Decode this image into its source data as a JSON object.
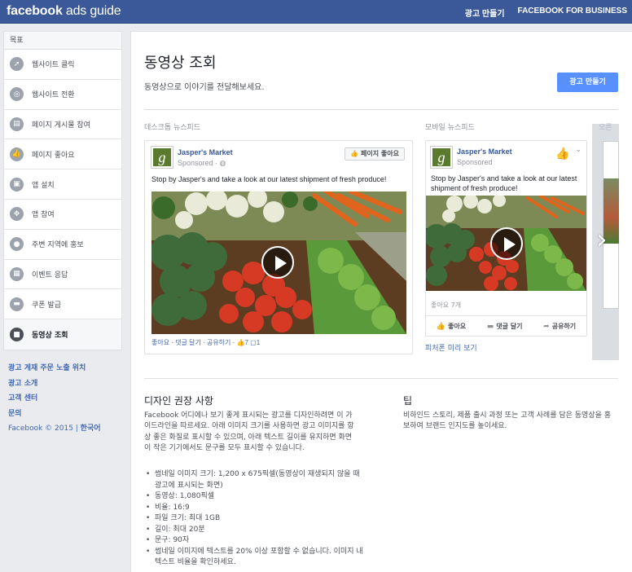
{
  "header": {
    "logo_bold": "facebook",
    "logo_thin": " ads guide",
    "nav": [
      "광고 만들기",
      "FACEBOOK FOR BUSINESS"
    ]
  },
  "sidebar": {
    "heading": "목표",
    "items": [
      {
        "label": "웹사이트 클릭",
        "icon": "cursor-icon"
      },
      {
        "label": "웹사이트 전환",
        "icon": "target-icon"
      },
      {
        "label": "페이지 게시물 참여",
        "icon": "post-icon"
      },
      {
        "label": "페이지 좋아요",
        "icon": "thumbs-up-icon"
      },
      {
        "label": "앱 설치",
        "icon": "box-icon"
      },
      {
        "label": "앱 참여",
        "icon": "controller-icon"
      },
      {
        "label": "주변 지역에 홍보",
        "icon": "location-pin-icon"
      },
      {
        "label": "이벤트 응답",
        "icon": "calendar-icon"
      },
      {
        "label": "쿠폰 발급",
        "icon": "coupon-icon"
      },
      {
        "label": "동영상 조회",
        "icon": "video-camera-icon"
      }
    ],
    "active_index": 9,
    "links": [
      "광고 게재 주문 노출 위치",
      "광고 소개",
      "고객 센터",
      "문의"
    ],
    "copyright": "Facebook © 2015 | ",
    "language": "한국어"
  },
  "main": {
    "title": "동영상 조회",
    "subtitle": "동영상으로 이야기를 전달해보세요.",
    "create_button": "광고 만들기",
    "desktop_label": "데스크톱 뉴스피드",
    "mobile_label": "모바일 뉴스피드",
    "right_label": "오른",
    "mobile_preview_link": "피처폰 미리 보기"
  },
  "ad": {
    "brand": "Jasper's Market",
    "logo_letter": "g",
    "sponsored": "Sponsored",
    "text": "Stop by Jasper's and take a look at our latest shipment of fresh produce!",
    "like_page_button": "👍 페이지 좋아요",
    "desktop_actions": "좋아요 · 댓글 달기 · 공유하기 · ",
    "like_count": "7",
    "comment_count": "1",
    "mobile_likes": "좋아요 7개",
    "mobile_like": "좋아요",
    "mobile_comment": "댓글 달기",
    "mobile_share": "공유하기"
  },
  "design": {
    "title": "디자인 권장 사항",
    "body": "Facebook 어디에나 보기 좋게 표시되는 광고를 디자인하려면 이 가이드라인을 따르세요. 아래 이미지 크기를 사용하면 광고 이미지를 항상 좋은 화질로 표시할 수 있으며, 아래 텍스트 길이를 유지하면 화면이 작은 기기에서도 문구를 모두 표시할 수 있습니다.",
    "bullets": [
      "썸네일 이미지 크기: 1,200 x 675픽셀(동영상이 재생되지 않을 때 광고에 표시되는 화면)",
      "동영상: 1,080픽셀",
      "비율: 16:9",
      "파일 크기: 최대 1GB",
      "길이: 최대 20분",
      "문구: 90자",
      "썸네일 이미지에 텍스트를 20% 이상 포함할 수 없습니다. 이미지 내 텍스트 비율을 확인하세요."
    ]
  },
  "tip": {
    "title": "팁",
    "body": "비하인드 스토리, 제품 출시 과정 또는 고객 사례를 담은 동영상을 홍보하여 브랜드 인지도를 높이세요."
  },
  "colors": {
    "brand_blue": "#3b5998",
    "button_blue": "#5890ff",
    "link_blue": "#4267b2"
  }
}
